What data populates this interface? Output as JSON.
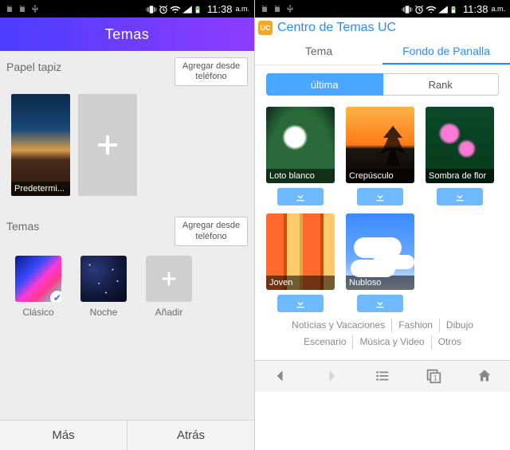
{
  "statusbar": {
    "time": "11:38",
    "ampm": "a.m."
  },
  "left": {
    "header": {
      "title": "Temas"
    },
    "wallpaper": {
      "title": "Papel tapiz",
      "add_from_phone": "Agregar desde teléfono",
      "items": [
        {
          "label": "Predetermi..."
        }
      ]
    },
    "themes": {
      "title": "Temas",
      "add_from_phone": "Agregar desde teléfono",
      "items": [
        {
          "label": "Clásico",
          "selected": true
        },
        {
          "label": "Noche"
        },
        {
          "label": "Añadir"
        }
      ]
    },
    "footer": {
      "more": "Más",
      "back": "Atrás"
    }
  },
  "right": {
    "header": {
      "logo": "UC",
      "title": "Centro de Temas UC"
    },
    "tabs": {
      "theme": "Tema",
      "wallpaper": "Fondo de Panalla"
    },
    "subtabs": {
      "latest": "última",
      "rank": "Rank"
    },
    "wallpapers": [
      {
        "label": "Loto blanco"
      },
      {
        "label": "Crepúsculo"
      },
      {
        "label": "Sombra de flor"
      },
      {
        "label": "Joven"
      },
      {
        "label": "Nubloso"
      }
    ],
    "categories": {
      "row1": [
        "Notícias y Vacaciones",
        "Fashion",
        "Dibujo"
      ],
      "row2": [
        "Escenario",
        "Música y Video",
        "Otros"
      ]
    },
    "nav": {
      "back": "back",
      "forward": "forward",
      "menu": "menu",
      "tabs_badge": "1",
      "home": "home"
    }
  },
  "colors": {
    "accent": "#2a8bff",
    "download_btn": "#6fb9ff",
    "header_gradient_from": "#4b3cff",
    "header_gradient_to": "#8d3cff"
  }
}
